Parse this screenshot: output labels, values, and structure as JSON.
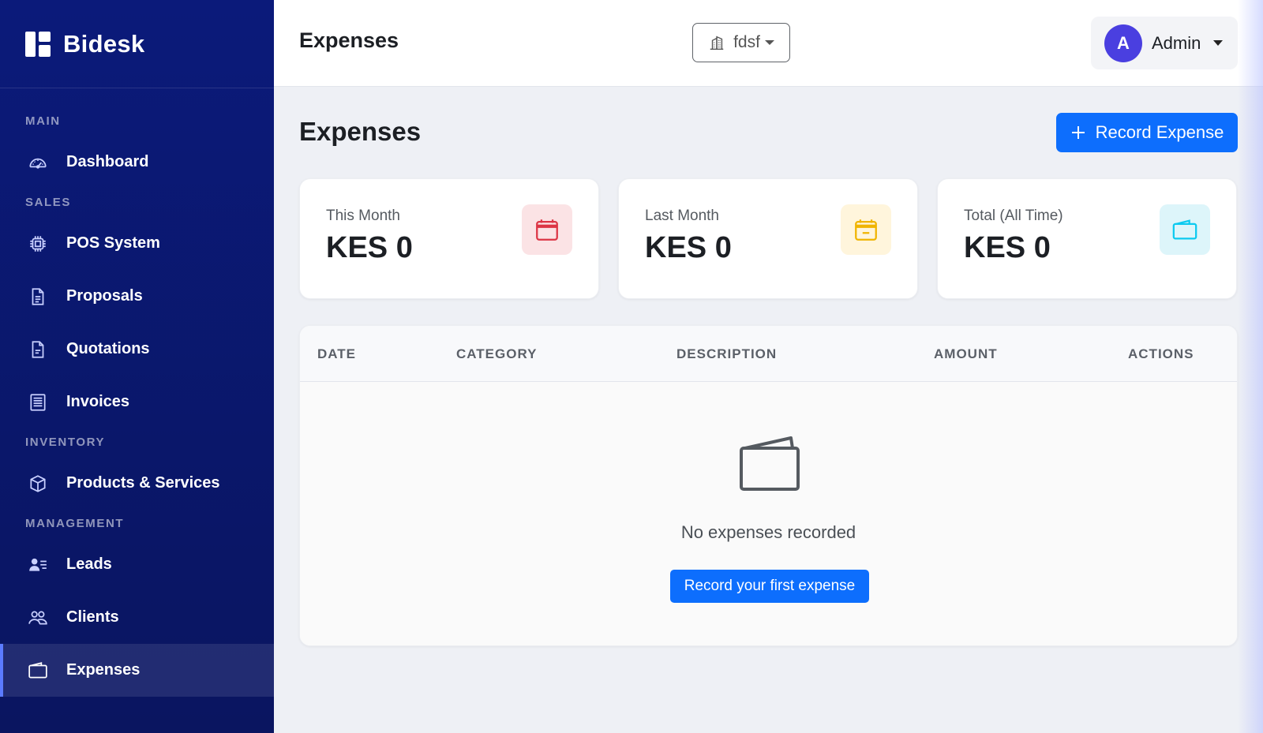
{
  "brand": {
    "name": "Bidesk"
  },
  "sidebar": {
    "sections": {
      "main": "MAIN",
      "sales": "SALES",
      "inventory": "INVENTORY",
      "management": "MANAGEMENT"
    },
    "items": {
      "dashboard": "Dashboard",
      "pos": "POS System",
      "proposals": "Proposals",
      "quotations": "Quotations",
      "invoices": "Invoices",
      "products": "Products & Services",
      "leads": "Leads",
      "clients": "Clients",
      "expenses": "Expenses"
    },
    "active": "expenses"
  },
  "header": {
    "title": "Expenses",
    "branch": "fdsf",
    "user": {
      "initial": "A",
      "name": "Admin"
    }
  },
  "main": {
    "title": "Expenses",
    "record_button": "Record Expense",
    "stats": [
      {
        "label": "This Month",
        "value": "KES 0",
        "icon": "calendar-icon",
        "color": "#dc3545"
      },
      {
        "label": "Last Month",
        "value": "KES 0",
        "icon": "calendar-minus-icon",
        "color": "#ffc107"
      },
      {
        "label": "Total (All Time)",
        "value": "KES 0",
        "icon": "wallet-icon",
        "color": "#0dcaf0"
      }
    ],
    "table": {
      "columns": [
        "DATE",
        "CATEGORY",
        "DESCRIPTION",
        "AMOUNT",
        "ACTIONS"
      ],
      "empty_text": "No expenses recorded",
      "empty_button": "Record your first expense"
    }
  },
  "colors": {
    "sidebar": "#0b1a7a",
    "primary": "#0d6efd"
  }
}
